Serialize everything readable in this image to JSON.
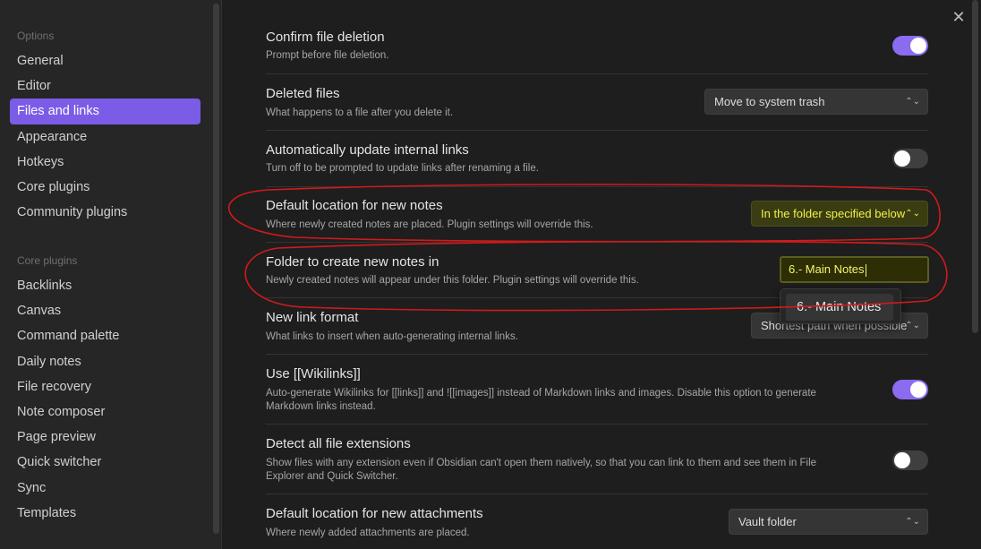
{
  "sidebar": {
    "options_heading": "Options",
    "options": [
      {
        "label": "General"
      },
      {
        "label": "Editor"
      },
      {
        "label": "Files and links"
      },
      {
        "label": "Appearance"
      },
      {
        "label": "Hotkeys"
      },
      {
        "label": "Core plugins"
      },
      {
        "label": "Community plugins"
      }
    ],
    "core_heading": "Core plugins",
    "core_plugins": [
      {
        "label": "Backlinks"
      },
      {
        "label": "Canvas"
      },
      {
        "label": "Command palette"
      },
      {
        "label": "Daily notes"
      },
      {
        "label": "File recovery"
      },
      {
        "label": "Note composer"
      },
      {
        "label": "Page preview"
      },
      {
        "label": "Quick switcher"
      },
      {
        "label": "Sync"
      },
      {
        "label": "Templates"
      }
    ],
    "active_item": "Files and links"
  },
  "main": {
    "close_icon": "close-icon",
    "settings": [
      {
        "name": "Confirm file deletion",
        "desc": "Prompt before file deletion.",
        "control": "toggle",
        "state": "on"
      },
      {
        "name": "Deleted files",
        "desc": "What happens to a file after you delete it.",
        "control": "dropdown",
        "value": "Move to system trash"
      },
      {
        "name": "Automatically update internal links",
        "desc": "Turn off to be prompted to update links after renaming a file.",
        "control": "toggle",
        "state": "off"
      },
      {
        "name": "Default location for new notes",
        "desc": "Where newly created notes are placed. Plugin settings will override this.",
        "control": "dropdown",
        "value": "In the folder specified below"
      },
      {
        "name": "Folder to create new notes in",
        "desc": "Newly created notes will appear under this folder. Plugin settings will override this.",
        "control": "text",
        "value": "6.- Main Notes"
      },
      {
        "name": "New link format",
        "desc": "What links to insert when auto-generating internal links.",
        "control": "dropdown",
        "value": "Shortest path when possible"
      },
      {
        "name": "Use [[Wikilinks]]",
        "desc": "Auto-generate Wikilinks for [[links]] and ![[images]] instead of Markdown links and images. Disable this option to generate Markdown links instead.",
        "control": "toggle",
        "state": "on"
      },
      {
        "name": "Detect all file extensions",
        "desc": "Show files with any extension even if Obsidian can't open them natively, so that you can link to them and see them in File Explorer and Quick Switcher.",
        "control": "toggle",
        "state": "off"
      },
      {
        "name": "Default location for new attachments",
        "desc": "Where newly added attachments are placed.",
        "control": "dropdown",
        "value": "Vault folder"
      }
    ],
    "suggestion": "6.- Main Notes"
  },
  "colors": {
    "accent": "#7b5ce6",
    "toggle_on": "#8b6cf0",
    "highlight_text": "#f0f04a",
    "annotation": "#d11a1a"
  }
}
